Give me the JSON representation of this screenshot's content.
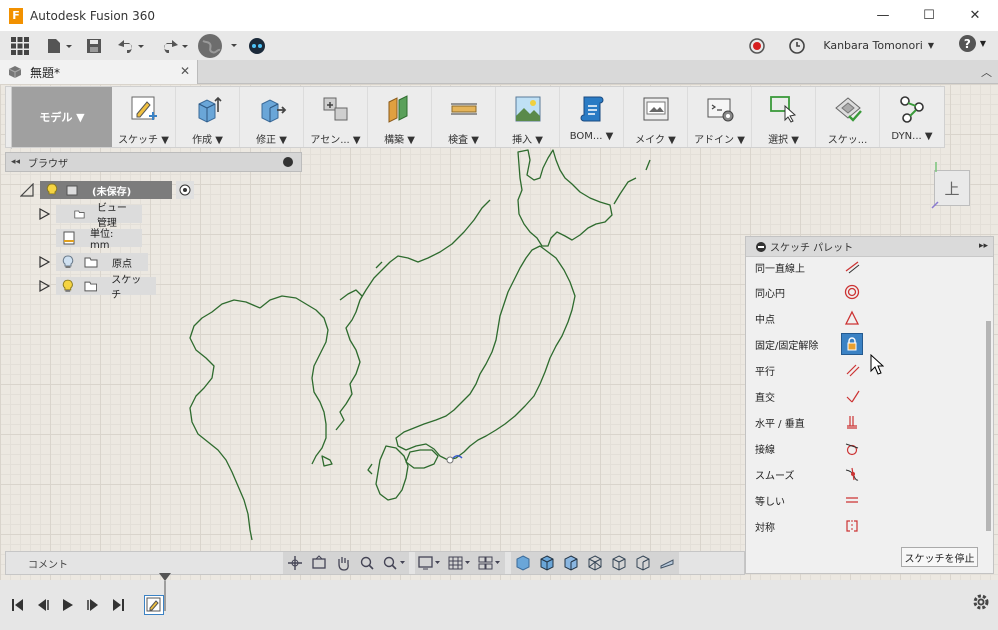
{
  "app": {
    "title": "Autodesk Fusion 360",
    "logo_letter": "F"
  },
  "window": {
    "minimize": "—",
    "maximize": "☐",
    "close": "✕"
  },
  "appbar": {
    "user_name": "Kanbara Tomonori",
    "user_caret": "▼",
    "help_icon": "?",
    "help_caret": "▼"
  },
  "tabs": {
    "document": "無題*",
    "close": "✕",
    "expand": "︿"
  },
  "toolbar": {
    "workspace": "モデル ▼",
    "groups": [
      {
        "label": "スケッチ ▼",
        "icon": "sketch-icon"
      },
      {
        "label": "作成 ▼",
        "icon": "create-icon"
      },
      {
        "label": "修正 ▼",
        "icon": "modify-icon"
      },
      {
        "label": "アセン... ▼",
        "icon": "assemble-icon"
      },
      {
        "label": "構築 ▼",
        "icon": "construct-icon"
      },
      {
        "label": "検査 ▼",
        "icon": "inspect-icon"
      },
      {
        "label": "挿入 ▼",
        "icon": "insert-icon"
      },
      {
        "label": "BOM... ▼",
        "icon": "bom-icon"
      },
      {
        "label": "メイク ▼",
        "icon": "make-icon"
      },
      {
        "label": "アドイン ▼",
        "icon": "addins-icon"
      },
      {
        "label": "選択 ▼",
        "icon": "select-icon"
      },
      {
        "label": "スケッ...",
        "icon": "sketch-finish-icon"
      },
      {
        "label": "DYN... ▼",
        "icon": "dynamo-icon"
      }
    ]
  },
  "browser": {
    "title": "ブラウザ",
    "collapse": "◂◂",
    "nodes": [
      {
        "label": "(未保存)"
      },
      {
        "label": "ビュー管理"
      },
      {
        "label": "単位: mm"
      },
      {
        "label": "原点"
      },
      {
        "label": "スケッチ"
      }
    ]
  },
  "palette": {
    "title": "スケッチ パレット",
    "expand": "▸▸",
    "items": [
      {
        "label": "同一直線上",
        "icon": "collinear-icon"
      },
      {
        "label": "同心円",
        "icon": "concentric-icon"
      },
      {
        "label": "中点",
        "icon": "midpoint-icon"
      },
      {
        "label": "固定/固定解除",
        "icon": "lock-icon"
      },
      {
        "label": "平行",
        "icon": "parallel-icon"
      },
      {
        "label": "直交",
        "icon": "perpendicular-icon"
      },
      {
        "label": "水平 / 垂直",
        "icon": "horizontal-vertical-icon"
      },
      {
        "label": "接線",
        "icon": "tangent-icon"
      },
      {
        "label": "スムーズ",
        "icon": "smooth-icon"
      },
      {
        "label": "等しい",
        "icon": "equal-icon"
      },
      {
        "label": "対称",
        "icon": "symmetry-icon"
      }
    ],
    "stop_button": "スケッチを停止"
  },
  "viewcube": {
    "face": "上"
  },
  "comment": {
    "label": "コメント"
  },
  "colors": {
    "accent": "#3b82c4",
    "record": "#d61f1f",
    "sketch_line": "#2e6b2e"
  }
}
